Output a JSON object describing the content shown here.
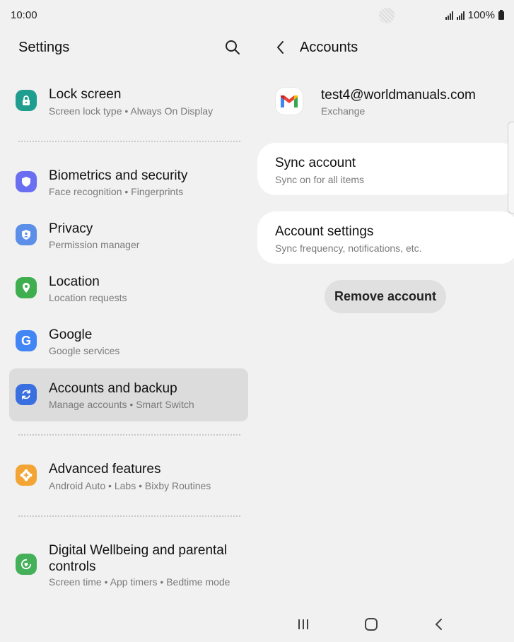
{
  "status": {
    "time": "10:00",
    "battery": "100%"
  },
  "left": {
    "title": "Settings",
    "items": [
      {
        "title": "Lock screen",
        "subtitle": "Screen lock type  •  Always On Display",
        "icon": "lock-icon",
        "color": "#1f9e8f"
      },
      {
        "title": "Biometrics and security",
        "subtitle": "Face recognition  •  Fingerprints",
        "icon": "shield-icon",
        "color": "#6a6ef0"
      },
      {
        "title": "Privacy",
        "subtitle": "Permission manager",
        "icon": "privacy-icon",
        "color": "#5b8fe8"
      },
      {
        "title": "Location",
        "subtitle": "Location requests",
        "icon": "location-pin-icon",
        "color": "#3fae4e"
      },
      {
        "title": "Google",
        "subtitle": "Google services",
        "icon": "google-icon",
        "color": "#4285f4"
      },
      {
        "title": "Accounts and backup",
        "subtitle": "Manage accounts  •  Smart Switch",
        "icon": "sync-icon",
        "color": "#3a6fe0"
      },
      {
        "title": "Advanced features",
        "subtitle": "Android Auto  •  Labs  •  Bixby Routines",
        "icon": "gear-plus-icon",
        "color": "#f2a534"
      },
      {
        "title": "Digital Wellbeing and parental controls",
        "subtitle": "Screen time  •  App timers  •  Bedtime mode",
        "icon": "wellbeing-icon",
        "color": "#45b05a"
      }
    ]
  },
  "right": {
    "title": "Accounts",
    "account": {
      "email": "test4@worldmanuals.com",
      "type": "Exchange",
      "icon": "gmail-icon"
    },
    "sync": {
      "title": "Sync account",
      "subtitle": "Sync on for all items"
    },
    "settings": {
      "title": "Account settings",
      "subtitle": "Sync frequency, notifications, etc."
    },
    "remove_label": "Remove account"
  }
}
